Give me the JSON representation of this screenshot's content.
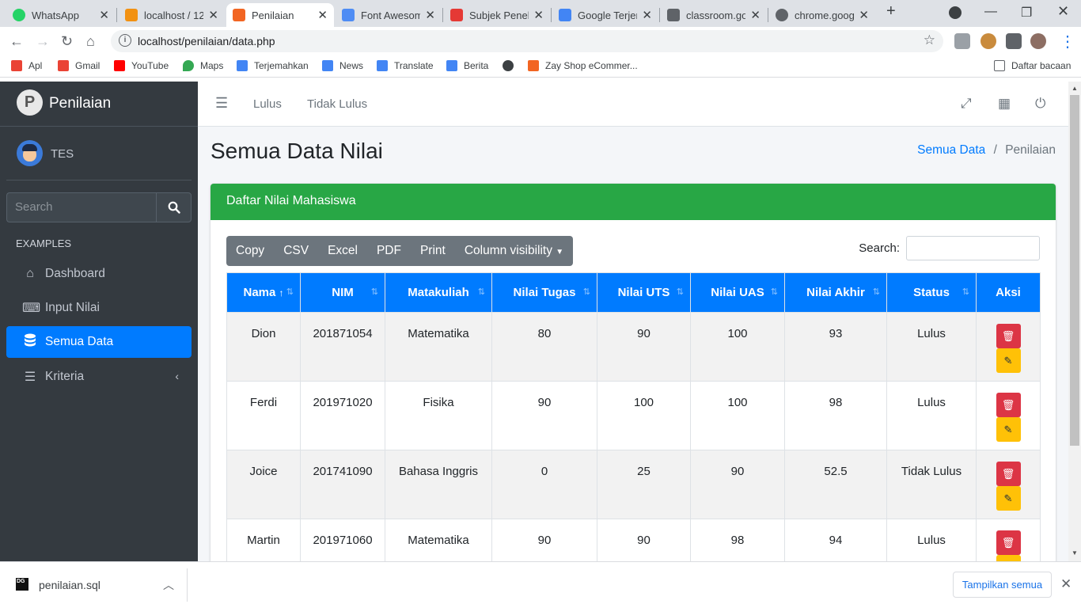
{
  "browser": {
    "tabs": [
      {
        "title": "WhatsApp",
        "color": "#25d366"
      },
      {
        "title": "localhost / 12",
        "color": "#f29111"
      },
      {
        "title": "Penilaian",
        "color": "#f26522"
      },
      {
        "title": "Font Awesom",
        "color": "#4e8cf4"
      },
      {
        "title": "Subjek Peneli",
        "color": "#e53935"
      },
      {
        "title": "Google Terjen",
        "color": "#4285f4"
      },
      {
        "title": "classroom.go",
        "color": "#5f6368"
      },
      {
        "title": "chrome.goog",
        "color": "#5f6368"
      }
    ],
    "url": "localhost/penilaian/data.php",
    "bookmarks": [
      {
        "label": "Apl",
        "color": "#ea4335"
      },
      {
        "label": "Gmail",
        "color": "#ea4335"
      },
      {
        "label": "YouTube",
        "color": "#ff0000"
      },
      {
        "label": "Maps",
        "color": "#34a853"
      },
      {
        "label": "Terjemahkan",
        "color": "#4285f4"
      },
      {
        "label": "News",
        "color": "#4285f4"
      },
      {
        "label": "Translate",
        "color": "#4285f4"
      },
      {
        "label": "Berita",
        "color": "#4285f4"
      },
      {
        "label": "",
        "color": "#3c4043"
      },
      {
        "label": "Zay Shop eCommer...",
        "color": "#f26522"
      }
    ],
    "reading_list": "Daftar bacaan"
  },
  "sidebar": {
    "brand": "Penilaian",
    "user": "TES",
    "search_placeholder": "Search",
    "header": "EXAMPLES",
    "items": [
      {
        "label": "Dashboard",
        "icon": "home-icon"
      },
      {
        "label": "Input Nilai",
        "icon": "keyboard-icon"
      },
      {
        "label": "Semua Data",
        "icon": "database-icon",
        "active": true
      },
      {
        "label": "Kriteria",
        "icon": "list-icon"
      }
    ]
  },
  "topnav": {
    "links": [
      "Lulus",
      "Tidak Lulus"
    ]
  },
  "page": {
    "title": "Semua Data Nilai",
    "breadcrumb_link": "Semua Data",
    "breadcrumb_sep": "/",
    "breadcrumb_current": "Penilaian"
  },
  "card": {
    "title": "Daftar Nilai Mahasiswa",
    "buttons": [
      "Copy",
      "CSV",
      "Excel",
      "PDF",
      "Print",
      "Column visibility"
    ],
    "search_label": "Search:"
  },
  "table": {
    "headers": [
      "Nama",
      "NIM",
      "Matakuliah",
      "Nilai Tugas",
      "Nilai UTS",
      "Nilai UAS",
      "Nilai Akhir",
      "Status",
      "Aksi"
    ],
    "rows": [
      [
        "Dion",
        "201871054",
        "Matematika",
        "80",
        "90",
        "100",
        "93",
        "Lulus"
      ],
      [
        "Ferdi",
        "201971020",
        "Fisika",
        "90",
        "100",
        "100",
        "98",
        "Lulus"
      ],
      [
        "Joice",
        "201741090",
        "Bahasa Inggris",
        "0",
        "25",
        "90",
        "52.5",
        "Tidak Lulus"
      ],
      [
        "Martin",
        "201971060",
        "Matematika",
        "90",
        "90",
        "98",
        "94",
        "Lulus"
      ]
    ]
  },
  "download": {
    "filename": "penilaian.sql",
    "show_all": "Tampilkan semua"
  }
}
